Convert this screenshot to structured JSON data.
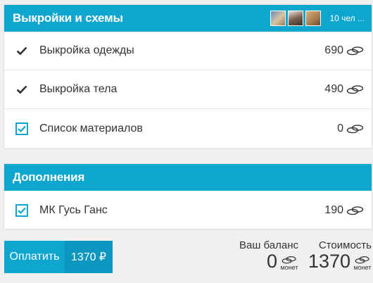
{
  "colors": {
    "accent": "#0ea5cf",
    "accent_dark": "#0b97bf",
    "background": "#f0f0f0"
  },
  "patterns": {
    "title": "Выкройки и схемы",
    "people_count": "10 чел ...",
    "items": [
      {
        "label": "Выкройка одежды",
        "price": "690",
        "state": "checkmark",
        "icon": "check-icon"
      },
      {
        "label": "Выкройка тела",
        "price": "490",
        "state": "checkmark",
        "icon": "check-icon"
      },
      {
        "label": "Список материалов",
        "price": "0",
        "state": "checkbox-checked",
        "icon": "checkbox-checked-icon"
      }
    ]
  },
  "addons": {
    "title": "Дополнения",
    "items": [
      {
        "label": "МК Гусь Ганс",
        "price": "190",
        "state": "checkbox-checked",
        "icon": "checkbox-checked-icon"
      }
    ]
  },
  "footer": {
    "pay_label": "Оплатить",
    "pay_sum": "1370 ₽",
    "balance_caption": "Ваш баланс",
    "balance_value": "0",
    "cost_caption": "Стоимость",
    "cost_value": "1370",
    "unit": "монет",
    "coin_icon": "coins-icon"
  }
}
